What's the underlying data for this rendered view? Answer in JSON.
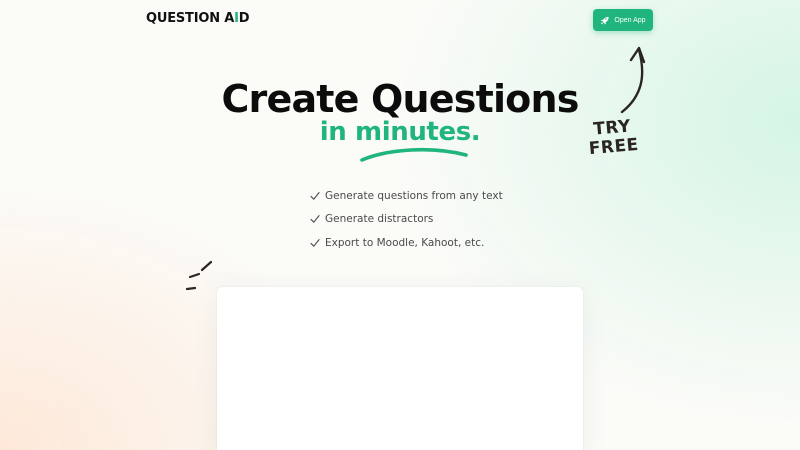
{
  "header": {
    "logo": {
      "main": "QUESTION A",
      "accent": "I",
      "end": "D"
    },
    "open_app": {
      "label": "Open App",
      "icon": "rocket-icon"
    }
  },
  "hero": {
    "title": "Create Questions",
    "subtitle": "in minutes."
  },
  "try_free": {
    "line1": "TRY",
    "line2": "FREE",
    "icon": "curved-arrow-up-icon"
  },
  "features": [
    {
      "label": "Generate questions from any text",
      "icon": "check-icon"
    },
    {
      "label": "Generate distractors",
      "icon": "check-icon"
    },
    {
      "label": "Export to Moodle, Kahoot, etc.",
      "icon": "check-icon"
    }
  ],
  "colors": {
    "accent": "#1fb57d",
    "text": "#0c0c0c",
    "muted": "#4a4a4a"
  }
}
